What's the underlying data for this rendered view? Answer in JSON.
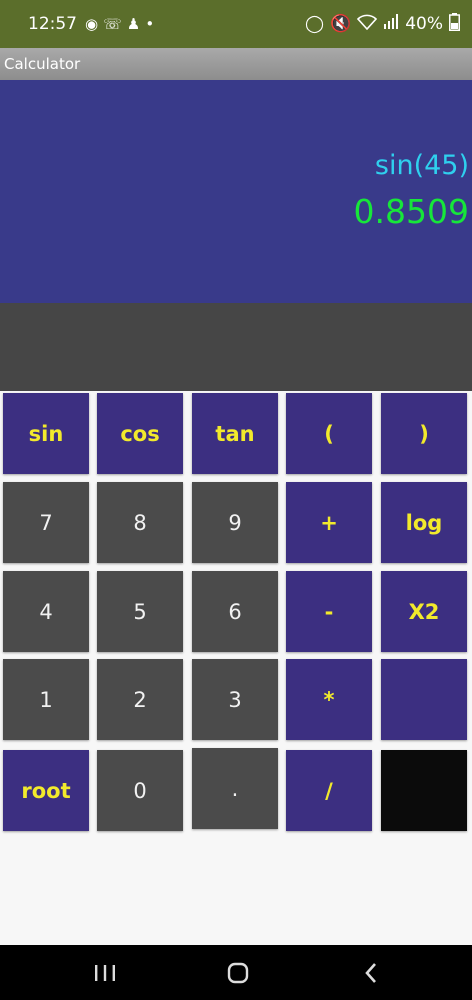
{
  "status_bar": {
    "time": "12:57",
    "left_icons": [
      "messenger-icon",
      "whatsapp-icon",
      "accessibility-icon",
      "dot-icon"
    ],
    "right_icons": [
      "battery-saver-icon",
      "mute-icon",
      "wifi-icon",
      "signal-icon"
    ],
    "battery": "40%"
  },
  "app": {
    "title": "Calculator"
  },
  "display": {
    "expression": "sin(45)",
    "result": "0.8509"
  },
  "keys": {
    "sin": "sin",
    "cos": "cos",
    "tan": "tan",
    "open_paren": "(",
    "close_paren": ")",
    "seven": "7",
    "eight": "8",
    "nine": "9",
    "plus": "+",
    "log": "log",
    "four": "4",
    "five": "5",
    "six": "6",
    "minus": "-",
    "square": "X2",
    "one": "1",
    "two": "2",
    "three": "3",
    "multiply": "*",
    "empty": "",
    "root": "root",
    "zero": "0",
    "dot": ".",
    "divide": "/",
    "dark": ""
  },
  "colors": {
    "status_bar": "#5b6e2b",
    "display_bg": "#393a8a",
    "expression": "#2fd0ee",
    "result": "#17e63a",
    "function_key": "#3c2f81",
    "function_key_text": "#f2ea2c",
    "number_key": "#4b4b4b"
  },
  "nav_bar": {
    "icons": [
      "recent-apps-icon",
      "home-icon",
      "back-icon"
    ]
  }
}
